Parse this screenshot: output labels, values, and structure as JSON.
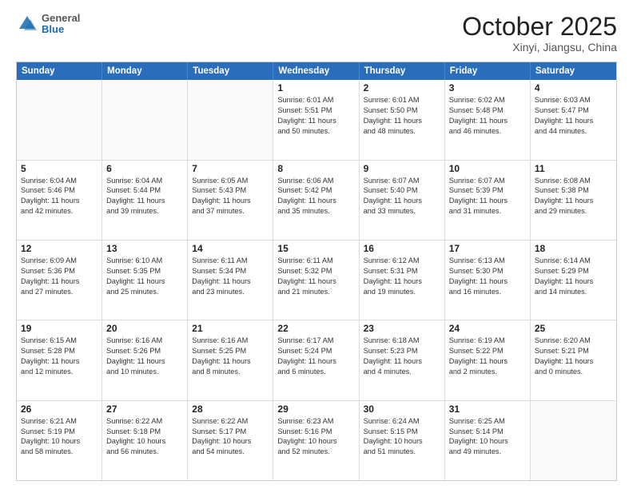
{
  "header": {
    "logo_line1": "General",
    "logo_line2": "Blue",
    "title": "October 2025",
    "subtitle": "Xinyi, Jiangsu, China"
  },
  "days_of_week": [
    "Sunday",
    "Monday",
    "Tuesday",
    "Wednesday",
    "Thursday",
    "Friday",
    "Saturday"
  ],
  "weeks": [
    [
      {
        "day": "",
        "content": ""
      },
      {
        "day": "",
        "content": ""
      },
      {
        "day": "",
        "content": ""
      },
      {
        "day": "1",
        "content": "Sunrise: 6:01 AM\nSunset: 5:51 PM\nDaylight: 11 hours\nand 50 minutes."
      },
      {
        "day": "2",
        "content": "Sunrise: 6:01 AM\nSunset: 5:50 PM\nDaylight: 11 hours\nand 48 minutes."
      },
      {
        "day": "3",
        "content": "Sunrise: 6:02 AM\nSunset: 5:48 PM\nDaylight: 11 hours\nand 46 minutes."
      },
      {
        "day": "4",
        "content": "Sunrise: 6:03 AM\nSunset: 5:47 PM\nDaylight: 11 hours\nand 44 minutes."
      }
    ],
    [
      {
        "day": "5",
        "content": "Sunrise: 6:04 AM\nSunset: 5:46 PM\nDaylight: 11 hours\nand 42 minutes."
      },
      {
        "day": "6",
        "content": "Sunrise: 6:04 AM\nSunset: 5:44 PM\nDaylight: 11 hours\nand 39 minutes."
      },
      {
        "day": "7",
        "content": "Sunrise: 6:05 AM\nSunset: 5:43 PM\nDaylight: 11 hours\nand 37 minutes."
      },
      {
        "day": "8",
        "content": "Sunrise: 6:06 AM\nSunset: 5:42 PM\nDaylight: 11 hours\nand 35 minutes."
      },
      {
        "day": "9",
        "content": "Sunrise: 6:07 AM\nSunset: 5:40 PM\nDaylight: 11 hours\nand 33 minutes."
      },
      {
        "day": "10",
        "content": "Sunrise: 6:07 AM\nSunset: 5:39 PM\nDaylight: 11 hours\nand 31 minutes."
      },
      {
        "day": "11",
        "content": "Sunrise: 6:08 AM\nSunset: 5:38 PM\nDaylight: 11 hours\nand 29 minutes."
      }
    ],
    [
      {
        "day": "12",
        "content": "Sunrise: 6:09 AM\nSunset: 5:36 PM\nDaylight: 11 hours\nand 27 minutes."
      },
      {
        "day": "13",
        "content": "Sunrise: 6:10 AM\nSunset: 5:35 PM\nDaylight: 11 hours\nand 25 minutes."
      },
      {
        "day": "14",
        "content": "Sunrise: 6:11 AM\nSunset: 5:34 PM\nDaylight: 11 hours\nand 23 minutes."
      },
      {
        "day": "15",
        "content": "Sunrise: 6:11 AM\nSunset: 5:32 PM\nDaylight: 11 hours\nand 21 minutes."
      },
      {
        "day": "16",
        "content": "Sunrise: 6:12 AM\nSunset: 5:31 PM\nDaylight: 11 hours\nand 19 minutes."
      },
      {
        "day": "17",
        "content": "Sunrise: 6:13 AM\nSunset: 5:30 PM\nDaylight: 11 hours\nand 16 minutes."
      },
      {
        "day": "18",
        "content": "Sunrise: 6:14 AM\nSunset: 5:29 PM\nDaylight: 11 hours\nand 14 minutes."
      }
    ],
    [
      {
        "day": "19",
        "content": "Sunrise: 6:15 AM\nSunset: 5:28 PM\nDaylight: 11 hours\nand 12 minutes."
      },
      {
        "day": "20",
        "content": "Sunrise: 6:16 AM\nSunset: 5:26 PM\nDaylight: 11 hours\nand 10 minutes."
      },
      {
        "day": "21",
        "content": "Sunrise: 6:16 AM\nSunset: 5:25 PM\nDaylight: 11 hours\nand 8 minutes."
      },
      {
        "day": "22",
        "content": "Sunrise: 6:17 AM\nSunset: 5:24 PM\nDaylight: 11 hours\nand 6 minutes."
      },
      {
        "day": "23",
        "content": "Sunrise: 6:18 AM\nSunset: 5:23 PM\nDaylight: 11 hours\nand 4 minutes."
      },
      {
        "day": "24",
        "content": "Sunrise: 6:19 AM\nSunset: 5:22 PM\nDaylight: 11 hours\nand 2 minutes."
      },
      {
        "day": "25",
        "content": "Sunrise: 6:20 AM\nSunset: 5:21 PM\nDaylight: 11 hours\nand 0 minutes."
      }
    ],
    [
      {
        "day": "26",
        "content": "Sunrise: 6:21 AM\nSunset: 5:19 PM\nDaylight: 10 hours\nand 58 minutes."
      },
      {
        "day": "27",
        "content": "Sunrise: 6:22 AM\nSunset: 5:18 PM\nDaylight: 10 hours\nand 56 minutes."
      },
      {
        "day": "28",
        "content": "Sunrise: 6:22 AM\nSunset: 5:17 PM\nDaylight: 10 hours\nand 54 minutes."
      },
      {
        "day": "29",
        "content": "Sunrise: 6:23 AM\nSunset: 5:16 PM\nDaylight: 10 hours\nand 52 minutes."
      },
      {
        "day": "30",
        "content": "Sunrise: 6:24 AM\nSunset: 5:15 PM\nDaylight: 10 hours\nand 51 minutes."
      },
      {
        "day": "31",
        "content": "Sunrise: 6:25 AM\nSunset: 5:14 PM\nDaylight: 10 hours\nand 49 minutes."
      },
      {
        "day": "",
        "content": ""
      }
    ]
  ]
}
